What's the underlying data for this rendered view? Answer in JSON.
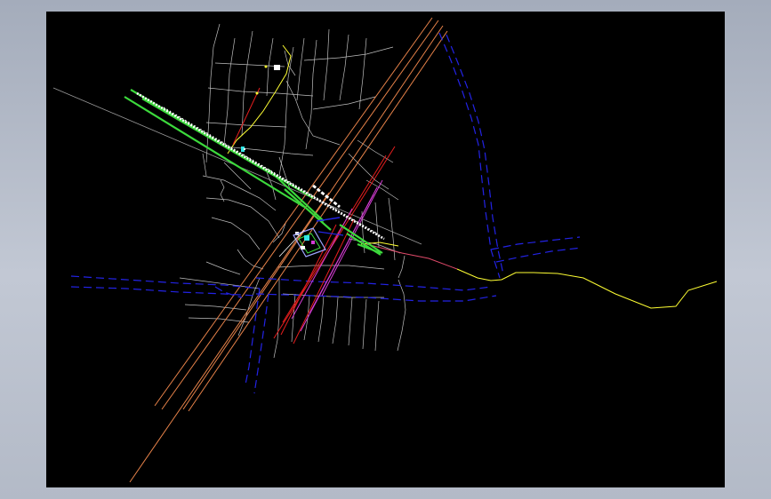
{
  "window": {
    "background": "#aab1bf"
  },
  "drawing": {
    "background": "#000000",
    "layer_colors": {
      "railway": "#e8834a",
      "waterway": "#2323e6",
      "road_green": "#3cd93c",
      "street_grid": "#bfbfbf",
      "boundary": "#ffff33",
      "utility_red": "#e61e1e",
      "utility_magenta": "#d23cd2",
      "building_white": "#ffffff",
      "cyan_marker": "#33e6e6"
    }
  }
}
